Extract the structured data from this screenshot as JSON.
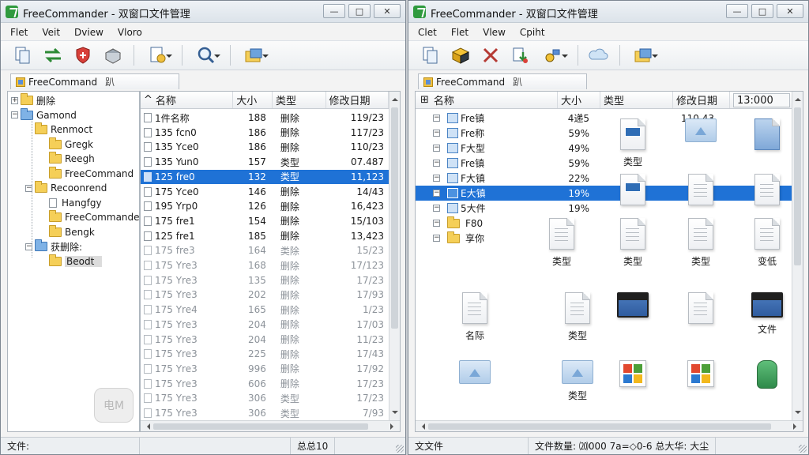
{
  "left": {
    "title": "FreeCommander - 双窗口文件管理",
    "menu": [
      "Flet",
      "Veit",
      "Dview",
      "Vloro"
    ],
    "tab": {
      "label": "FreeCommand",
      "extra": "趴"
    },
    "tree": [
      {
        "label": "删除",
        "level": 0,
        "expander": "+",
        "folder": "yellow"
      },
      {
        "label": "Gamond",
        "level": 0,
        "expander": "-",
        "folder": "blue"
      },
      {
        "label": "Renmoct",
        "level": 1,
        "expander": "",
        "folder": "yellow"
      },
      {
        "label": "Gregk",
        "level": 2,
        "expander": "",
        "folder": "yellow"
      },
      {
        "label": "Reegh",
        "level": 2,
        "expander": "",
        "folder": "yellow"
      },
      {
        "label": "FreeCommand",
        "level": 2,
        "expander": "",
        "folder": "yellow"
      },
      {
        "label": "Recoonrend",
        "level": 1,
        "expander": "-",
        "folder": "yellow"
      },
      {
        "label": "Hangfgy",
        "level": 2,
        "expander": "",
        "folder": "file"
      },
      {
        "label": "FreeCommander",
        "level": 2,
        "expander": "",
        "folder": "yellow"
      },
      {
        "label": "Bengk",
        "level": 2,
        "expander": "",
        "folder": "yellow"
      },
      {
        "label": "获删除:",
        "level": 1,
        "expander": "-",
        "folder": "blue"
      },
      {
        "label": "Beodt",
        "level": 2,
        "expander": "",
        "folder": "yellow",
        "selected": true
      }
    ],
    "columns": {
      "name": "名称",
      "size": "大小",
      "type": "类型",
      "date": "修改日期"
    },
    "rows": [
      {
        "name": "1件名称",
        "size": "188",
        "type": "删除",
        "date": "119/23"
      },
      {
        "name": "135 fcn0",
        "size": "186",
        "type": "删除",
        "date": "117/23"
      },
      {
        "name": "135 Yce0",
        "size": "186",
        "type": "删除",
        "date": "110/23"
      },
      {
        "name": "135 Yun0",
        "size": "157",
        "type": "类型",
        "date": "07.487"
      },
      {
        "name": "125 fre0",
        "size": "132",
        "type": "类型",
        "date": "11,123",
        "selected": true
      },
      {
        "name": "175 Yce0",
        "size": "146",
        "type": "删除",
        "date": "14/43"
      },
      {
        "name": "195 Yrp0",
        "size": "126",
        "type": "删除",
        "date": "16,423"
      },
      {
        "name": "175 fre1",
        "size": "154",
        "type": "删除",
        "date": "15/103"
      },
      {
        "name": "125 fre1",
        "size": "185",
        "type": "删除",
        "date": "13,423"
      },
      {
        "name": "175 fre3",
        "size": "164",
        "type": "类除",
        "date": "15/23",
        "faded": true
      },
      {
        "name": "175 Yre3",
        "size": "168",
        "type": "删除",
        "date": "17/123",
        "faded": true
      },
      {
        "name": "175 Yre3",
        "size": "135",
        "type": "删除",
        "date": "17/23",
        "faded": true
      },
      {
        "name": "175 Yre3",
        "size": "202",
        "type": "删除",
        "date": "17/93",
        "faded": true
      },
      {
        "name": "175 Yre4",
        "size": "165",
        "type": "删除",
        "date": "1/23",
        "faded": true
      },
      {
        "name": "175 Yre3",
        "size": "204",
        "type": "删除",
        "date": "17/03",
        "faded": true
      },
      {
        "name": "175 Yre3",
        "size": "204",
        "type": "删除",
        "date": "11/23",
        "faded": true
      },
      {
        "name": "175 Yre3",
        "size": "225",
        "type": "删除",
        "date": "17/43",
        "faded": true
      },
      {
        "name": "175 Yre3",
        "size": "996",
        "type": "删除",
        "date": "17/92",
        "faded": true
      },
      {
        "name": "175 Yre3",
        "size": "606",
        "type": "删除",
        "date": "17/23",
        "faded": true
      },
      {
        "name": "175 Yre3",
        "size": "306",
        "type": "类型",
        "date": "17/23",
        "faded": true
      },
      {
        "name": "175 Yre3",
        "size": "306",
        "type": "类型",
        "date": "7/93",
        "faded": true
      }
    ],
    "watermark": "电M",
    "status": {
      "files": "文件:",
      "total": "总总10"
    }
  },
  "right": {
    "title": "FreeCommander - 双窗口文件管理",
    "menu": [
      "Clet",
      "Flet",
      "Vlew",
      "Cpiht"
    ],
    "tab": {
      "label": "FreeCommand",
      "extra": "趴"
    },
    "columns": {
      "name": "名称",
      "size": "大小",
      "type": "类型",
      "date": "修改日期",
      "extra": "13:000"
    },
    "rows": [
      {
        "name": "Fre镇",
        "size": "4递5",
        "date": "110.43"
      },
      {
        "name": "Fre称",
        "size": "59%",
        "date": ""
      },
      {
        "name": "F大型",
        "size": "49%",
        "date": ""
      },
      {
        "name": "Fre镇",
        "size": "59%",
        "date": ""
      },
      {
        "name": "F大镇",
        "size": "22%",
        "date": ""
      },
      {
        "name": "E大镇",
        "size": "19%",
        "date": "",
        "selected": true
      },
      {
        "name": "5大件",
        "size": "19%",
        "date": ""
      },
      {
        "name": "F80",
        "size": "",
        "date": ""
      },
      {
        "name": "享你",
        "size": "",
        "date": ""
      }
    ],
    "icons": [
      {
        "kind": "doc-blue",
        "label": "类型"
      },
      {
        "kind": "folder-light",
        "label": ""
      },
      {
        "kind": "doc-blue-plain",
        "label": ""
      },
      {
        "kind": "doc-blue-inner",
        "label": ""
      },
      {
        "kind": "doc",
        "label": ""
      },
      {
        "kind": "doc",
        "label": ""
      },
      {
        "kind": "doc",
        "label": "类型"
      },
      {
        "kind": "doc",
        "label": "类型"
      },
      {
        "kind": "doc",
        "label": "类型"
      },
      {
        "kind": "doc",
        "label": "变低"
      },
      {
        "kind": "doc",
        "label": "名际"
      },
      {
        "kind": "doc",
        "label": "类型"
      },
      {
        "kind": "folder-dark",
        "label": ""
      },
      {
        "kind": "doc",
        "label": ""
      },
      {
        "kind": "folder-dark",
        "label": "文件"
      },
      {
        "kind": "folder-light",
        "label": ""
      },
      {
        "kind": "image",
        "label": "类型"
      },
      {
        "kind": "winlogo",
        "label": ""
      },
      {
        "kind": "winlogo",
        "label": ""
      },
      {
        "kind": "green-bag",
        "label": ""
      }
    ],
    "status": {
      "text": "文文件",
      "count": "文件数量:",
      "v1": "⒇000",
      "v2": "7a=◇0-6",
      "v3": "总大华:",
      "v4": "大尘"
    }
  }
}
